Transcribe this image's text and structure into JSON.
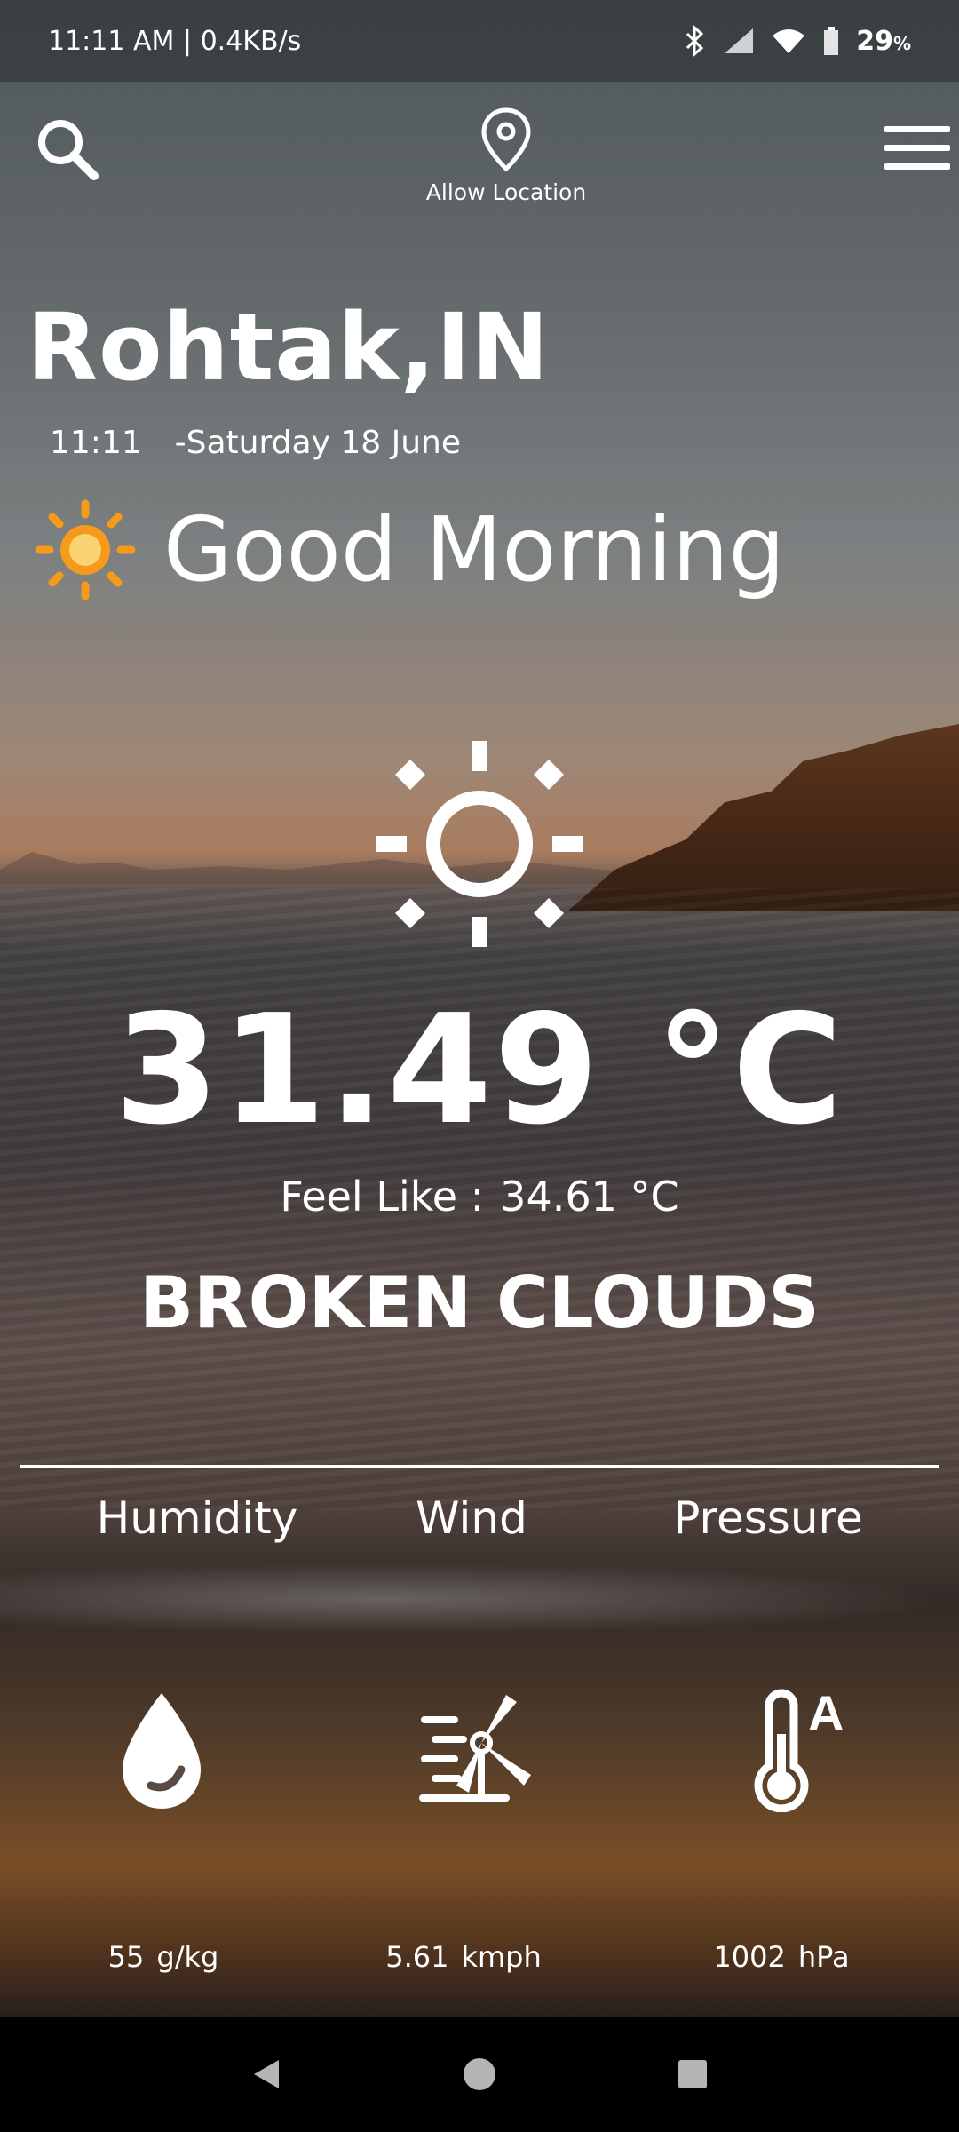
{
  "status_bar": {
    "time": "11:11 AM | 0.4KB/s",
    "battery": "29",
    "battery_unit": "%",
    "icons": [
      "bluetooth-icon",
      "signal-icon",
      "wifi-icon",
      "battery-icon"
    ]
  },
  "top_bar": {
    "search_icon": "search-icon",
    "location_icon": "location-pin-icon",
    "location_label": "Allow Location",
    "menu_icon": "hamburger-menu-icon"
  },
  "weather": {
    "city": "Rohtak,IN",
    "time": "11:11",
    "date": "-Saturday 18 June",
    "greeting": "Good Morning",
    "greeting_icon": "sun-icon",
    "condition_icon": "sun-outline-icon",
    "temperature": "31.49 °C",
    "feels_label": "Feel Like :",
    "feels_value": "34.61 °C",
    "description": "BROKEN CLOUDS"
  },
  "metrics": [
    {
      "label": "Humidity",
      "icon": "water-drop-icon",
      "value": "55",
      "unit": "g/kg"
    },
    {
      "label": "Wind",
      "icon": "wind-turbine-icon",
      "value": "5.61",
      "unit": "kmph"
    },
    {
      "label": "Pressure",
      "icon": "thermometer-icon",
      "value": "1002",
      "unit": "hPa"
    }
  ],
  "nav_bar": {
    "icons": [
      "back-icon",
      "home-icon",
      "recents-icon"
    ]
  },
  "colors": {
    "accent_sun": "#f59a1b",
    "text": "#ffffff"
  }
}
